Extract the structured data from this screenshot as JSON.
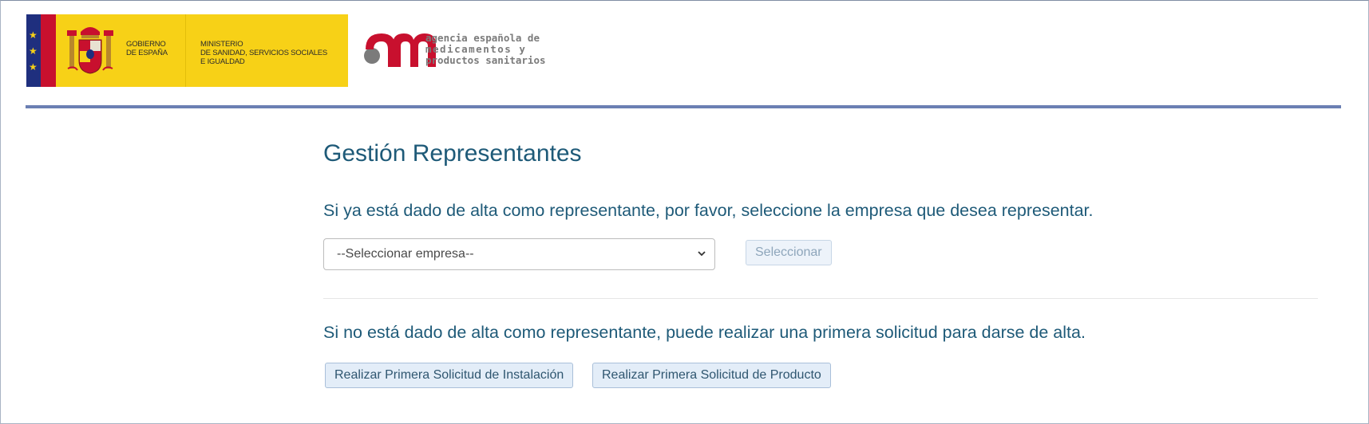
{
  "header": {
    "gov_logo": {
      "gobierno_line1": "GOBIERNO",
      "gobierno_line2": "DE ESPAÑA",
      "ministerio_line1": "MINISTERIO",
      "ministerio_line2": "DE SANIDAD, SERVICIOS SOCIALES",
      "ministerio_line3": "E IGUALDAD",
      "icon": "coat-of-arms-icon"
    },
    "aemps_logo": {
      "line1": "agencia española de",
      "line2": "medicamentos y",
      "line3": "productos sanitarios",
      "icon": "aemps-logo-icon"
    },
    "colors": {
      "rule": "#6b7fb3",
      "gov_yellow": "#f7d117",
      "aemps_red": "#c8102e"
    }
  },
  "main": {
    "title": "Gestión Representantes",
    "registered_prompt": "Si ya está dado de alta como representante, por favor, seleccione la empresa que desea representar.",
    "company_select": {
      "value": "--Seleccionar empresa--",
      "icon": "chevron-down-icon"
    },
    "select_button": "Seleccionar",
    "unregistered_prompt": "Si no está dado de alta como representante, puede realizar una primera solicitud para darse de alta.",
    "install_request_button": "Realizar Primera Solicitud de Instalación",
    "product_request_button": "Realizar Primera Solicitud de Producto",
    "colors": {
      "text": "#1e5a78",
      "button_bg": "#e3edf8"
    }
  }
}
